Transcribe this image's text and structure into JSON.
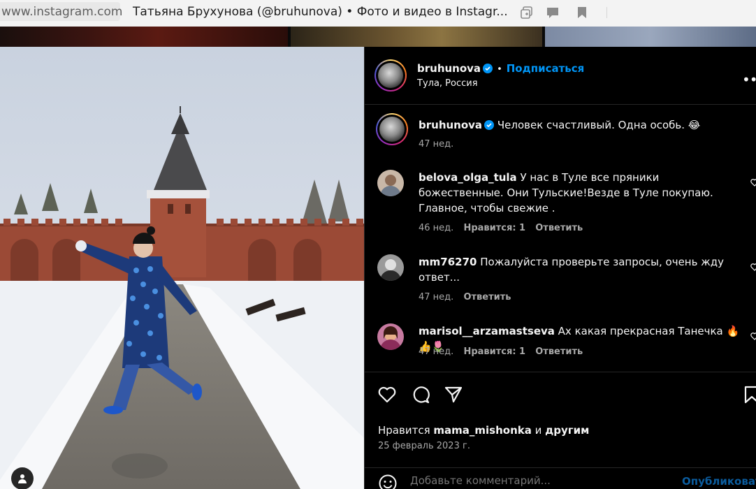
{
  "browser": {
    "url": "www.instagram.com",
    "title": "Татьяна Брухунова (@bruhunova) • Фото и видео в Instagr..."
  },
  "post": {
    "author": "bruhunova",
    "follow_label": "Подписаться",
    "separator": "•",
    "location": "Тула, Россия",
    "more_label": "•••",
    "caption": {
      "username": "bruhunova",
      "text": "Человек счастливый. Одна особь. 😂",
      "age": "47 нед."
    },
    "comments": [
      {
        "username": "belova_olga_tula",
        "text": "У нас в Туле все пряники божественные. Они Тульские!Везде в Туле покупаю. Главное, чтобы свежие .",
        "age": "46 нед.",
        "likes": "Нравится: 1",
        "reply": "Ответить"
      },
      {
        "username": "mm76270",
        "text": "Пожалуйста проверьте запросы, очень жду ответ...",
        "age": "47 нед.",
        "reply": "Ответить"
      },
      {
        "username": "marisol__arzamastseva",
        "text": "Ах какая прекрасная Танечка 🔥👍🌷",
        "age": "47 нед.",
        "likes": "Нравится: 1",
        "reply": "Ответить"
      }
    ],
    "likes_prefix": "Нравится",
    "likes_user": "mama_mishonka",
    "likes_and": "и",
    "likes_others": "другим",
    "date": "25 февраль 2023 г.",
    "comment_placeholder": "Добавьте комментарий...",
    "publish_label": "Опубликовать"
  },
  "colors": {
    "accent": "#0095f6",
    "panel_bg": "#000000",
    "muted": "#a8a8a8",
    "border": "#262626"
  },
  "icons": [
    "tab-copy-icon",
    "chat-icon",
    "bookmark-icon",
    "heart-icon",
    "comment-icon",
    "share-icon",
    "save-icon",
    "emoji-icon",
    "user-tag-icon",
    "verified-icon",
    "more-icon"
  ]
}
